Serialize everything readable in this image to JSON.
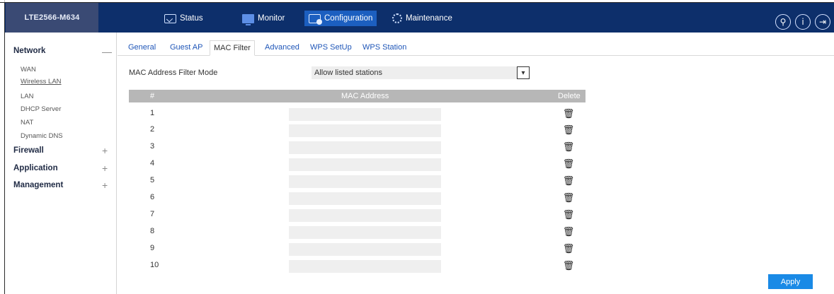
{
  "header": {
    "model": "LTE2566-M634",
    "nav": [
      {
        "label": "Status",
        "icon": "status-icon",
        "active": false
      },
      {
        "label": "Monitor",
        "icon": "monitor-icon",
        "active": false
      },
      {
        "label": "Configuration",
        "icon": "configuration-icon",
        "active": true
      },
      {
        "label": "Maintenance",
        "icon": "maintenance-icon",
        "active": false
      }
    ],
    "buttons": [
      {
        "name": "wizard-icon",
        "glyph": "⚲"
      },
      {
        "name": "info-icon",
        "glyph": "i"
      },
      {
        "name": "logout-icon",
        "glyph": "⇥"
      }
    ],
    "colors": {
      "bar": "#0d2f6b",
      "active": "#1c5fc0",
      "accent": "#1a8ae6"
    }
  },
  "sidebar": {
    "groups": [
      {
        "label": "Network",
        "toggle": "—",
        "expanded": true,
        "items": [
          "WAN",
          "Wireless LAN",
          "LAN",
          "DHCP Server",
          "NAT",
          "Dynamic DNS"
        ],
        "current": "Wireless LAN"
      },
      {
        "label": "Firewall",
        "toggle": "+",
        "expanded": false
      },
      {
        "label": "Application",
        "toggle": "+",
        "expanded": false
      },
      {
        "label": "Management",
        "toggle": "+",
        "expanded": false
      }
    ]
  },
  "tabs": [
    "General",
    "Guest AP",
    "MAC Filter",
    "Advanced",
    "WPS SetUp",
    "WPS Station"
  ],
  "active_tab": "MAC Filter",
  "filter": {
    "mode_label": "MAC Address Filter Mode",
    "mode_value": "Allow listed stations",
    "arrow": "▾"
  },
  "table": {
    "col_num": "#",
    "col_mac": "MAC Address",
    "col_delete": "Delete",
    "rows": [
      {
        "num": "1",
        "mac": ""
      },
      {
        "num": "2",
        "mac": ""
      },
      {
        "num": "3",
        "mac": ""
      },
      {
        "num": "4",
        "mac": ""
      },
      {
        "num": "5",
        "mac": ""
      },
      {
        "num": "6",
        "mac": ""
      },
      {
        "num": "7",
        "mac": ""
      },
      {
        "num": "8",
        "mac": ""
      },
      {
        "num": "9",
        "mac": ""
      },
      {
        "num": "10",
        "mac": ""
      }
    ],
    "delete_icon": "🗑"
  },
  "apply_label": "Apply"
}
